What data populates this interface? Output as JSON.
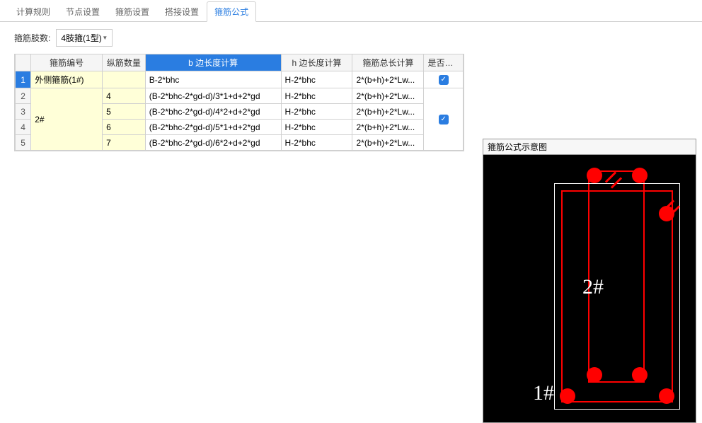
{
  "tabs": {
    "t0": "计算规则",
    "t1": "节点设置",
    "t2": "箍筋设置",
    "t3": "搭接设置",
    "t4": "箍筋公式"
  },
  "toolbar": {
    "label": "箍筋肢数:",
    "dropdown_value": "4肢箍(1型)"
  },
  "table": {
    "headers": {
      "name": "箍筋编号",
      "count": "纵筋数量",
      "b": "b 边长度计算",
      "h": "h 边长度计算",
      "total": "箍筋总长计算",
      "output": "是否输出"
    },
    "rows": [
      {
        "num": "1",
        "name": "外侧箍筋(1#)",
        "count": "",
        "b": "B-2*bhc",
        "h": "H-2*bhc",
        "total": "2*(b+h)+2*Lw...",
        "output": true
      },
      {
        "num": "2",
        "name": "",
        "count": "4",
        "b": "(B-2*bhc-2*gd-d)/3*1+d+2*gd",
        "h": "H-2*bhc",
        "total": "2*(b+h)+2*Lw...",
        "output": null
      },
      {
        "num": "3",
        "name": "2#",
        "count": "5",
        "b": "(B-2*bhc-2*gd-d)/4*2+d+2*gd",
        "h": "H-2*bhc",
        "total": "2*(b+h)+2*Lw...",
        "output": true
      },
      {
        "num": "4",
        "name": "",
        "count": "6",
        "b": "(B-2*bhc-2*gd-d)/5*1+d+2*gd",
        "h": "H-2*bhc",
        "total": "2*(b+h)+2*Lw...",
        "output": null
      },
      {
        "num": "5",
        "name": "",
        "count": "7",
        "b": "(B-2*bhc-2*gd-d)/6*2+d+2*gd",
        "h": "H-2*bhc",
        "total": "2*(b+h)+2*Lw...",
        "output": null
      }
    ]
  },
  "diagram": {
    "title": "箍筋公式示意图",
    "label1": "1#",
    "label2": "2#"
  }
}
